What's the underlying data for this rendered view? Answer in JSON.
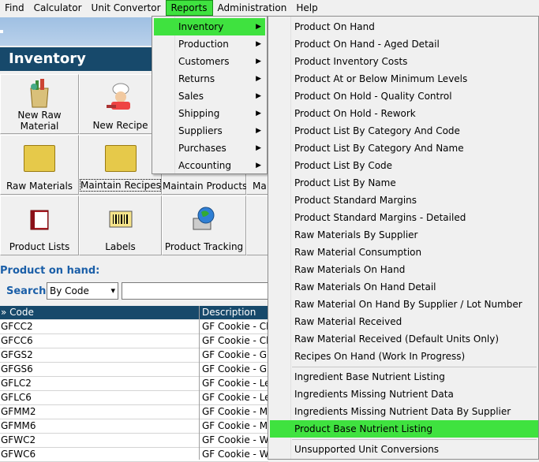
{
  "menubar": [
    "Find",
    "Calculator",
    "Unit Convertor",
    "Reports",
    "Administration",
    "Help"
  ],
  "section_title": "Inventory",
  "tiles": [
    {
      "label1": "New Raw",
      "label2": "Material",
      "icon": "groceries-bag-icon"
    },
    {
      "label1": "New Recipe",
      "label2": "",
      "icon": "chef-icon"
    },
    {
      "label1": "Raw Materials",
      "icon": "folder-icon"
    },
    {
      "label1": "Maintain Recipes",
      "icon": "folder-chef-icon"
    },
    {
      "label1": "Maintain Products",
      "icon": ""
    },
    {
      "label1": "Ma",
      "icon": ""
    },
    {
      "label1": "Product Lists",
      "icon": "book-icon"
    },
    {
      "label1": "Labels",
      "icon": "barcode-icon"
    },
    {
      "label1": "Product Tracking",
      "icon": "globe-computer-icon"
    }
  ],
  "product_on_hand_label": "Product on hand:",
  "search": {
    "label": "Search:",
    "selected": "By Code",
    "value": ""
  },
  "grid": {
    "headers": [
      "» Code",
      "Description"
    ],
    "rows": [
      [
        "GFCC2",
        "GF Cookie - Ch"
      ],
      [
        "GFCC6",
        "GF Cookie - Ch"
      ],
      [
        "GFGS2",
        "GF Cookie - Gi"
      ],
      [
        "GFGS6",
        "GF Cookie - Gi"
      ],
      [
        "GFLC2",
        "GF Cookie - Le"
      ],
      [
        "GFLC6",
        "GF Cookie - Le"
      ],
      [
        "GFMM2",
        "GF Cookie - M&"
      ],
      [
        "GFMM6",
        "GF Cookie - M&"
      ],
      [
        "GFWC2",
        "GF Cookie - Wh"
      ],
      [
        "GFWC6",
        "GF Cookie - Wh"
      ]
    ]
  },
  "reports_menu": [
    "Inventory",
    "Production",
    "Customers",
    "Returns",
    "Sales",
    "Shipping",
    "Suppliers",
    "Purchases",
    "Accounting"
  ],
  "inventory_submenu": {
    "group1": [
      "Product On Hand",
      "Product On Hand - Aged Detail",
      "Product Inventory Costs",
      "Product At or Below Minimum Levels",
      "Product On Hold - Quality Control",
      "Product On Hold - Rework",
      "Product List By Category And Code",
      "Product List By Category And Name",
      "Product List By Code",
      "Product List By Name",
      "Product Standard Margins",
      "Product Standard Margins - Detailed",
      "Raw Materials By Supplier",
      "Raw Material Consumption",
      "Raw Materials On Hand",
      "Raw Materials On Hand Detail",
      "Raw Material On Hand By Supplier / Lot Number",
      "Raw Material Received",
      "Raw Material Received (Default Units Only)",
      "Recipes On Hand (Work In Progress)"
    ],
    "group2": [
      "Ingredient Base Nutrient Listing",
      "Ingredients Missing Nutrient Data",
      "Ingredients Missing Nutrient Data By Supplier",
      "Product Base Nutrient Listing"
    ],
    "group3": [
      "Unsupported Unit Conversions"
    ]
  },
  "colors": {
    "highlight": "#3fe23f",
    "title_bar": "#17496b",
    "label_blue": "#1b5fa8"
  }
}
